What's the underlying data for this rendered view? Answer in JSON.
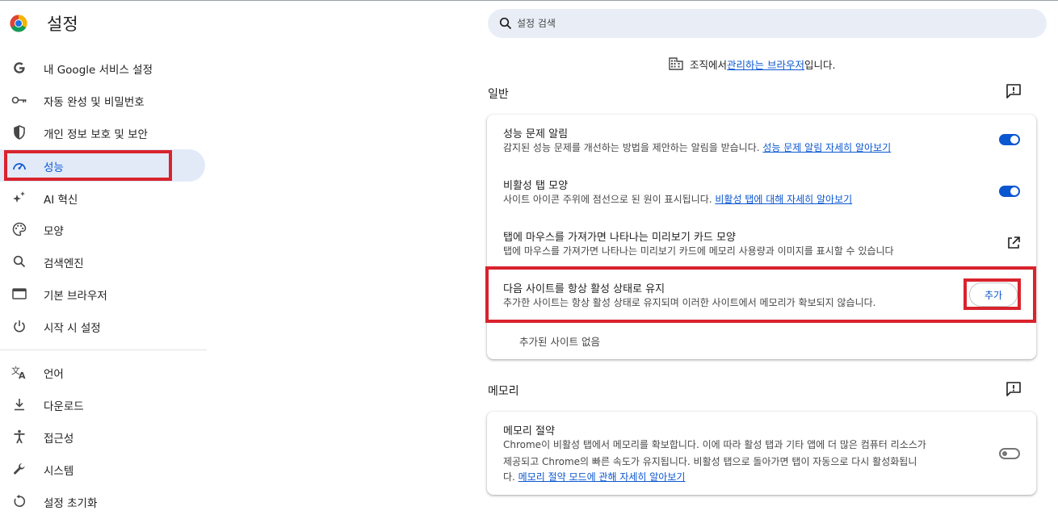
{
  "app": {
    "title": "설정"
  },
  "search": {
    "placeholder": "설정 검색"
  },
  "sidebar": {
    "items": [
      {
        "label": "내 Google 서비스 설정",
        "icon": "google-g-icon"
      },
      {
        "label": "자동 완성 및 비밀번호",
        "icon": "key-icon"
      },
      {
        "label": "개인 정보 보호 및 보안",
        "icon": "shield-icon"
      },
      {
        "label": "성능",
        "icon": "speedometer-icon",
        "active": true
      },
      {
        "label": "AI 혁신",
        "icon": "sparkle-icon"
      },
      {
        "label": "모양",
        "icon": "palette-icon"
      },
      {
        "label": "검색엔진",
        "icon": "search-icon"
      },
      {
        "label": "기본 브라우저",
        "icon": "browser-window-icon"
      },
      {
        "label": "시작 시 설정",
        "icon": "power-icon"
      }
    ],
    "items2": [
      {
        "label": "언어",
        "icon": "translate-icon"
      },
      {
        "label": "다운로드",
        "icon": "download-icon"
      },
      {
        "label": "접근성",
        "icon": "accessibility-icon"
      },
      {
        "label": "시스템",
        "icon": "wrench-icon"
      },
      {
        "label": "설정 초기화",
        "icon": "reset-icon"
      }
    ]
  },
  "managed": {
    "prefix": "조직에서 ",
    "link": "관리하는 브라우저",
    "suffix": "입니다."
  },
  "general": {
    "title": "일반",
    "rows": [
      {
        "title": "성능 문제 알림",
        "desc": "감지된 성능 문제를 개선하는 방법을 제안하는 알림을 받습니다. ",
        "link": "성능 문제 알림 자세히 알아보기",
        "toggle": "on"
      },
      {
        "title": "비활성 탭 모양",
        "desc": "사이트 아이콘 주위에 점선으로 된 원이 표시됩니다. ",
        "link": "비활성 탭에 대해 자세히 알아보기",
        "toggle": "on"
      },
      {
        "title": "탭에 마우스를 가져가면 나타나는 미리보기 카드 모양",
        "desc": "탭에 마우스를 가져가면 나타나는 미리보기 카드에 메모리 사용량과 이미지를 표시할 수 있습니다"
      },
      {
        "title": "다음 사이트를 항상 활성 상태로 유지",
        "desc": "추가한 사이트는 항상 활성 상태로 유지되며 이러한 사이트에서 메모리가 확보되지 않습니다.",
        "button": "추가"
      }
    ],
    "empty": "추가된 사이트 없음"
  },
  "memory": {
    "title": "메모리",
    "row": {
      "title": "메모리 절약",
      "line1": "Chrome이 비활성 탭에서 메모리를 확보합니다. 이에 따라 활성 탭과 기타 앱에 더 많은 컴퓨터 리소스가",
      "line2": "제공되고 Chrome의 빠른 속도가 유지됩니다. 비활성 탭으로 돌아가면 탭이 자동으로 다시 활성화됩니",
      "line3_prefix": "다. ",
      "link": "메모리 절약 모드에 관해 자세히 알아보기",
      "toggle": "off"
    }
  },
  "colors": {
    "accent": "#0b57d0",
    "highlight": "#d9232d",
    "active_bg": "#e2eaf8"
  }
}
